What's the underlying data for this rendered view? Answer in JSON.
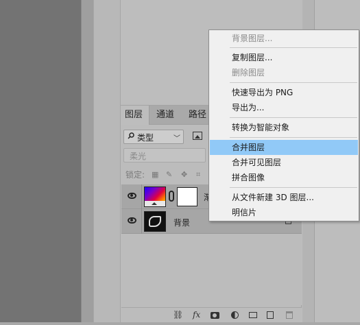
{
  "layers_panel": {
    "tabs": [
      "图层",
      "通道",
      "路径"
    ],
    "filter_kind": "类型",
    "blend_mode": "柔光",
    "lock_label": "锁定:",
    "layers": [
      {
        "name": "渐",
        "visible": true,
        "has_mask": true
      },
      {
        "name": "背景",
        "visible": true,
        "locked": true
      }
    ],
    "toolbar": {
      "fx_label": "fx"
    }
  },
  "context_menu": {
    "items": [
      {
        "label": "背景图层...",
        "disabled": true
      },
      {
        "label": "复制图层...",
        "disabled": false
      },
      {
        "label": "删除图层",
        "disabled": true
      },
      {
        "label": "快速导出为 PNG",
        "disabled": false
      },
      {
        "label": "导出为...",
        "disabled": false
      },
      {
        "label": "转换为智能对象",
        "disabled": false
      },
      {
        "label": "合并图层",
        "disabled": false,
        "selected": true
      },
      {
        "label": "合并可见图层",
        "disabled": false
      },
      {
        "label": "拼合图像",
        "disabled": false
      },
      {
        "label": "从文件新建 3D 图层...",
        "disabled": false
      },
      {
        "label": "明信片",
        "disabled": false
      }
    ]
  },
  "colors": {
    "menu_highlight": "#91c9f7",
    "panel_bg": "#bdbdbd",
    "canvas_bg": "#737373"
  }
}
